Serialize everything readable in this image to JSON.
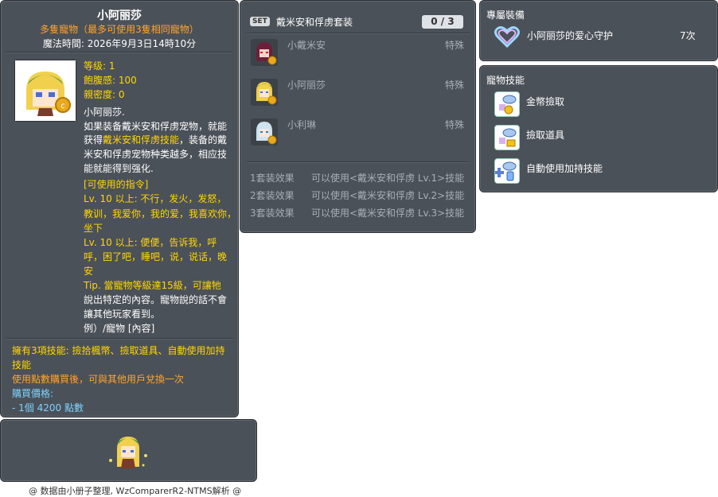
{
  "item_id": "05000495",
  "pet": {
    "name": "小阿丽莎",
    "multi_pet": "多隻寵物（最多可使用3隻相同寵物）",
    "magic_time": "魔法時間:  2026年9月3日14時10分",
    "stats": {
      "level": "等级: 1",
      "fullness": "飽腹感: 100",
      "closeness": "親密度: 0"
    },
    "desc_name": "小阿丽莎.",
    "desc_lines": [
      "如果装备戴米安和俘虏宠物，就能",
      "获得",
      "戴米安和俘虏技能",
      "，装备的戴",
      "米安和俘虏宠物种类越多，相应技",
      "能就能得到强化."
    ],
    "commands_title": "[可使用的指令]",
    "commands_lines": [
      "Lv. 10 以上:  不行，发火，发怒，",
      "教训，我爱你，我的爱，我喜欢你，",
      "坐下",
      "Lv. 10 以上:  便便，告诉我，呼",
      "呼，困了吧，睡吧，说，说话，晚",
      "安"
    ],
    "tip_lines": [
      "Tip. 當寵物等級達15級，可讓牠",
      "說出特定的內容。寵物說的話不會",
      "讓其他玩家看到。",
      "例）/寵物 [內容]"
    ],
    "skills_lines": [
      "擁有3項技能: 撿拾楓幣、撿取道具、自動使用加持",
      "技能"
    ],
    "trade_note": "使用點數購買後，可與其他用戶兌換一次",
    "price_label": "購買價格:",
    "price_value": " - 1個 4200 點數"
  },
  "set": {
    "badge": "SET",
    "name": "戴米安和俘虏套装",
    "count": "0 / 3",
    "items": [
      {
        "name": "小戴米安",
        "type": "特殊"
      },
      {
        "name": "小阿丽莎",
        "type": "特殊"
      },
      {
        "name": "小利琳",
        "type": "特殊"
      }
    ],
    "effects": [
      {
        "label": "1套装效果",
        "text": "可以使用<戴米安和俘虏 Lv.1>技能"
      },
      {
        "label": "2套装效果",
        "text": "可以使用<戴米安和俘虏 Lv.2>技能"
      },
      {
        "label": "3套装效果",
        "text": "可以使用<戴米安和俘虏 Lv.3>技能"
      }
    ]
  },
  "exclusive": {
    "title": "專屬裝備",
    "item_name": "小阿丽莎的爱心守护",
    "item_count": "7次"
  },
  "pet_skills": {
    "title": "寵物技能",
    "items": [
      "金幣撿取",
      "撿取道具",
      "自動使用加持技能"
    ]
  },
  "footer": "@ 数据由小册子整理, WzComparerR2-NTMS解析 @",
  "colors": {
    "panel_bg": "#4b5159",
    "orange": "#ffa42b",
    "yellow": "#ffd700",
    "cyan": "#7ed3ff"
  }
}
